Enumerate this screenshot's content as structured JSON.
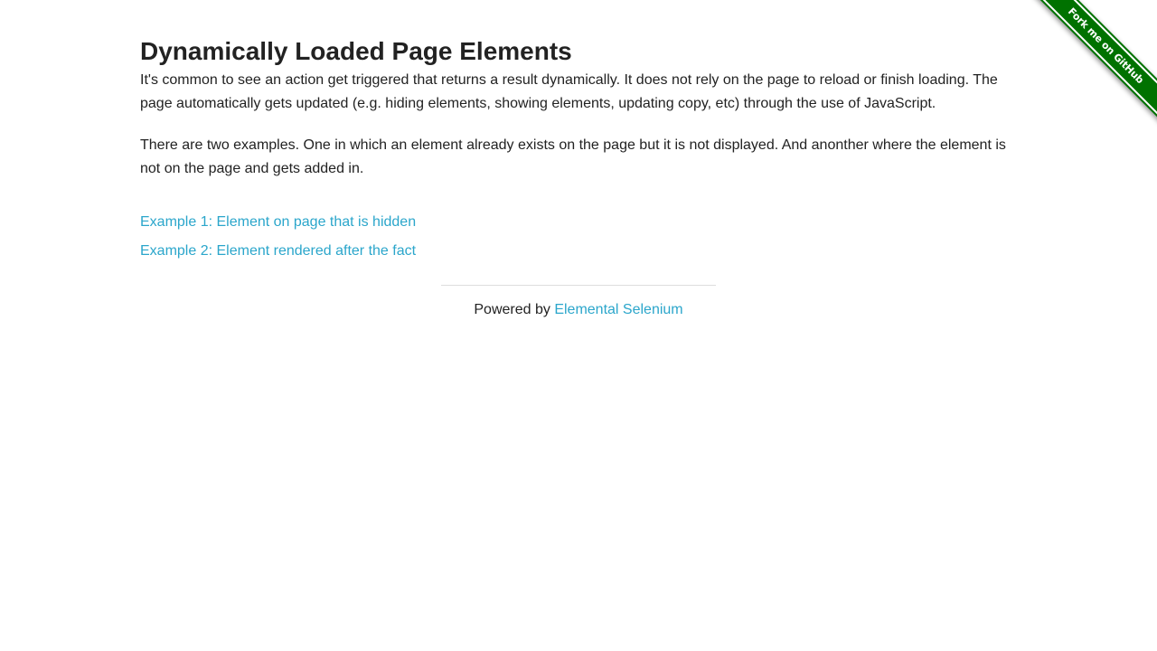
{
  "page": {
    "title": "Dynamically Loaded Page Elements",
    "paragraphs": [
      "It's common to see an action get triggered that returns a result dynamically. It does not rely on the page to reload or finish loading. The page automatically gets updated (e.g. hiding elements, showing elements, updating copy, etc) through the use of JavaScript.",
      "There are two examples. One in which an element already exists on the page but it is not displayed. And anonther where the element is not on the page and gets added in."
    ],
    "links": [
      "Example 1: Element on page that is hidden",
      "Example 2: Element rendered after the fact"
    ]
  },
  "footer": {
    "prefix": "Powered by",
    "link_label": "Elemental Selenium"
  },
  "ribbon": {
    "label": "Fork me on GitHub",
    "color": "#007200"
  },
  "colors": {
    "link": "#2ba6cb",
    "text": "#222222"
  }
}
